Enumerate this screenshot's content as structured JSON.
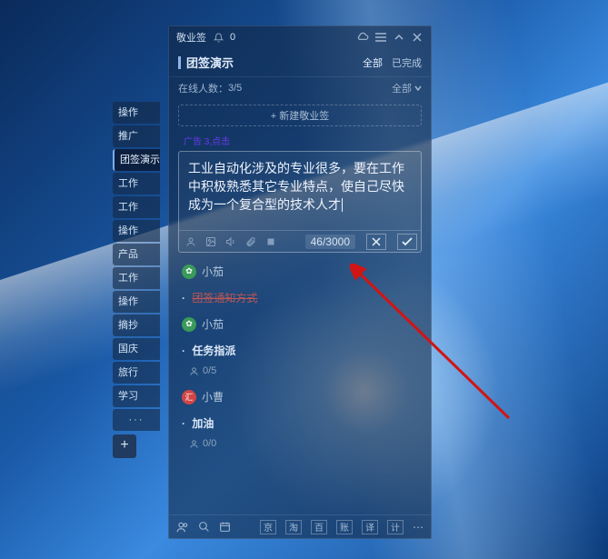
{
  "titlebar": {
    "app_name": "敬业签",
    "bell_count": "0"
  },
  "section": {
    "title": "团签演示",
    "filter_all": "全部",
    "filter_done": "已完成"
  },
  "online": {
    "label": "在线人数：",
    "count": "3/5",
    "dropdown": "全部"
  },
  "new_note_label": "+ 新建敬业签",
  "sub_hint": "广告 3,点击",
  "editor": {
    "text": "工业自动化涉及的专业很多，要在工作中积极熟悉其它专业特点，使自己尽快成为一个复合型的技术人才",
    "count": "46",
    "max": "3000"
  },
  "items": [
    {
      "type": "user",
      "avatar": "green",
      "name": "小茄"
    },
    {
      "type": "note",
      "bullet": true,
      "struck": true,
      "text": "团签通知方式"
    },
    {
      "type": "user",
      "avatar": "green",
      "name": "小茄"
    },
    {
      "type": "task",
      "bullet": true,
      "text": "任务指派",
      "people": "0/5"
    },
    {
      "type": "user",
      "avatar": "red",
      "name": "小曹"
    },
    {
      "type": "note",
      "bullet": true,
      "text": "加油",
      "people": "0/0"
    }
  ],
  "tabs": [
    "操作",
    "推广",
    "团签演示",
    "工作",
    "工作",
    "操作",
    "产品",
    "工作",
    "操作",
    "摘抄",
    "国庆",
    "旅行",
    "学习",
    "···"
  ],
  "bottom": {
    "boxes": [
      "京",
      "淘",
      "百",
      "账",
      "译",
      "计"
    ]
  }
}
